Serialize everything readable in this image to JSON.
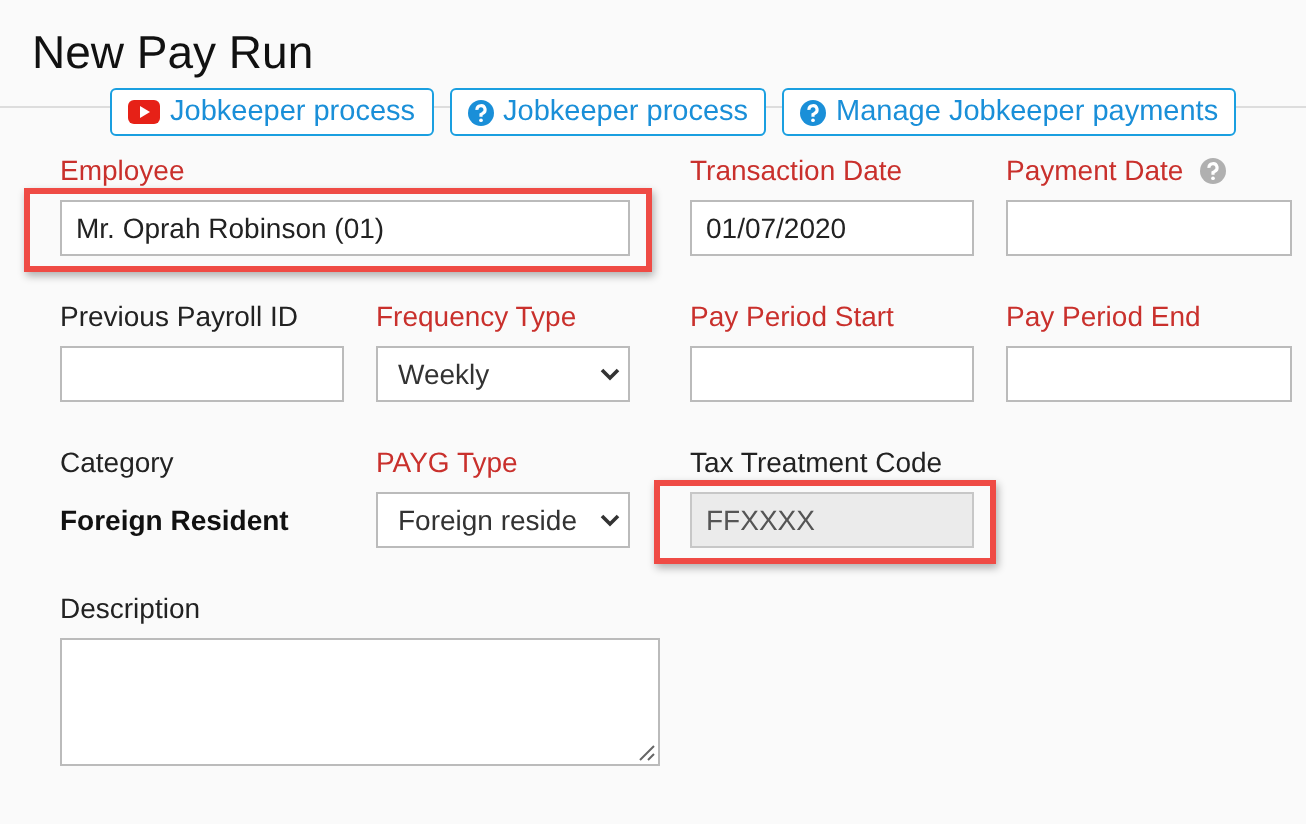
{
  "title": "New Pay Run",
  "buttons": [
    {
      "label": "Jobkeeper process",
      "kind": "video"
    },
    {
      "label": "Jobkeeper process",
      "kind": "help"
    },
    {
      "label": "Manage Jobkeeper payments",
      "kind": "help"
    }
  ],
  "rows": [
    [
      {
        "label": "Employee",
        "required": true,
        "kind": "lookup",
        "value": "Mr. Oprah Robinson (01)",
        "highlighted": true
      },
      {
        "label": "Transaction Date",
        "required": true,
        "kind": "text",
        "value": "01/07/2020"
      },
      {
        "label": "Payment Date",
        "required": true,
        "kind": "text",
        "help": true
      }
    ],
    [
      {
        "label": "Previous Payroll ID",
        "required": false,
        "kind": "text"
      },
      {
        "label": "Frequency Type",
        "required": true,
        "kind": "select",
        "value": "Weekly"
      },
      {
        "label": "Pay Period Start",
        "required": true,
        "kind": "text"
      },
      {
        "label": "Pay Period End",
        "required": true,
        "kind": "text"
      }
    ],
    [
      {
        "label": "Category",
        "required": false,
        "kind": "static",
        "value": "Foreign Resident"
      },
      {
        "label": "PAYG Type",
        "required": true,
        "kind": "select",
        "value": "Foreign reside"
      },
      {
        "label": "Tax Treatment Code",
        "required": false,
        "kind": "readonly",
        "value": "FFXXXX",
        "highlighted": true
      }
    ],
    [
      {
        "label": "Description",
        "required": false,
        "kind": "textarea"
      }
    ]
  ]
}
